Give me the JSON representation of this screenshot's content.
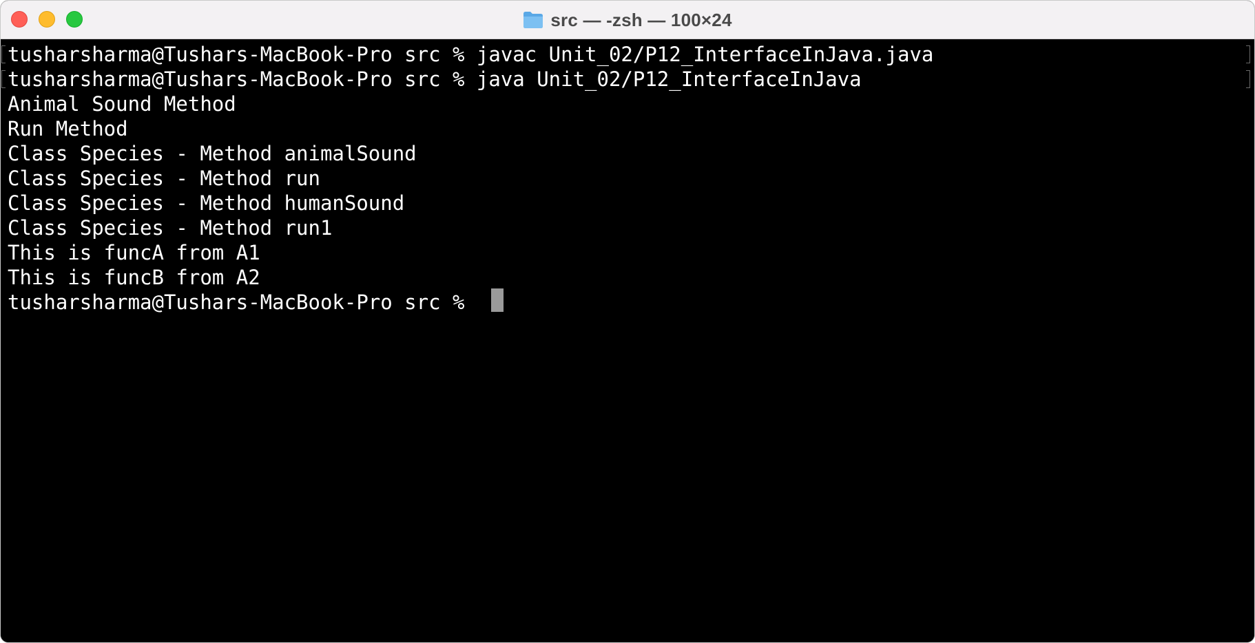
{
  "window": {
    "title": "src — -zsh — 100×24",
    "folder_icon": "folder-icon",
    "controls": [
      "close",
      "minimize",
      "zoom"
    ]
  },
  "terminal": {
    "lines": [
      "tusharsharma@Tushars-MacBook-Pro src % javac Unit_02/P12_InterfaceInJava.java",
      "tusharsharma@Tushars-MacBook-Pro src % java Unit_02/P12_InterfaceInJava",
      "Animal Sound Method",
      "Run Method",
      "Class Species - Method animalSound",
      "Class Species - Method run",
      "Class Species - Method humanSound",
      "Class Species - Method run1",
      "This is funcA from A1",
      "This is funcB from A2",
      "tusharsharma@Tushars-MacBook-Pro src % "
    ]
  },
  "colors": {
    "background": "#000000",
    "text": "#ffffff",
    "cursor": "#9a9a9a",
    "titlebar": "#f3f1f3"
  }
}
